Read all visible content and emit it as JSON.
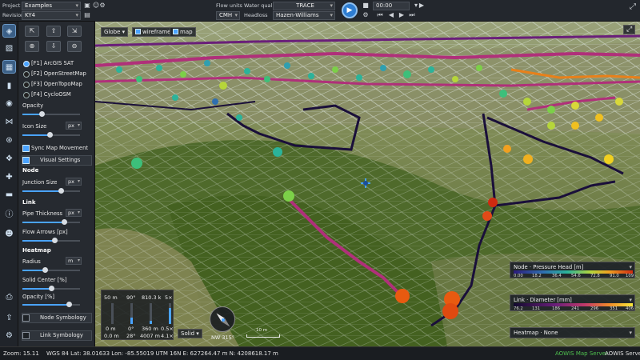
{
  "topbar": {
    "project_label": "Project",
    "project_value": "Examples",
    "revision_label": "Revision",
    "revision_value": "KY4",
    "flow_units_label": "Flow units",
    "flow_units_value": "CMH",
    "water_quality_label": "Water quality",
    "water_quality_value": "TRACE",
    "headloss_label": "Headloss",
    "headloss_value": "Hazen-Williams",
    "time_value": "00:00"
  },
  "panel": {
    "basemaps": [
      {
        "label": "[F1] ArcGIS SAT",
        "selected": true
      },
      {
        "label": "[F2] OpenStreetMap",
        "selected": false
      },
      {
        "label": "[F3] OpenTopoMap",
        "selected": false
      },
      {
        "label": "[F4] CycloOSM",
        "selected": false
      }
    ],
    "opacity_label": "Opacity",
    "icon_size_label": "Icon Size",
    "unit_px": "px",
    "unit_m": "m",
    "sync_map_label": "Sync Map Movement",
    "visual_settings_label": "Visual Settings",
    "node_heading": "Node",
    "junction_size_label": "Junction Size",
    "link_heading": "Link",
    "pipe_thickness_label": "Pipe Thickness",
    "flow_arrows_label": "Flow Arrows [px]",
    "heatmap_heading": "Heatmap",
    "radius_label": "Radius",
    "solid_center_label": "Solid Center [%]",
    "heat_opacity_label": "Opacity [%]",
    "node_symbology_label": "Node Symbology",
    "link_symbology_label": "Link Symbology"
  },
  "map": {
    "mode_value": "Globe",
    "wireframe_label": "wireframe",
    "map_label": "map",
    "camera": {
      "col1_top": "50 m",
      "col1_mid": "0 m",
      "col1_bot": "0.0 m",
      "col2_top": "90°",
      "col2_mid": "0°",
      "col2_bot": "28°",
      "col3_top": "810.3 k",
      "col3_mid": "360 m",
      "col3_bot": "4007 m",
      "col4_top": "5×",
      "col4_mid": "0.5×",
      "col4_bot": "4.1×"
    },
    "render_mode": "Solid",
    "heading_readout": "NW  315°",
    "scale_label": "10 m"
  },
  "legends": [
    {
      "title": "Node · Pressure Head [m]",
      "ticks": [
        "0.00",
        "18.2",
        "36.4",
        "54.6",
        "72.8",
        "91.0",
        "109"
      ]
    },
    {
      "title": "Link · Diameter [mm]",
      "ticks": [
        "76.2",
        "131",
        "186",
        "241",
        "296",
        "351",
        "406"
      ]
    },
    {
      "title": "Heatmap · None",
      "ticks": []
    }
  ],
  "status": {
    "zoom": "Zoom: 15.11",
    "coords": "WGS 84 Lat: 38.01633  Lon: -85.55019   UTM 16N E: 627264.47 m  N: 4208618.17 m",
    "map_server": "AOWIS Map Server",
    "server": "AOWIS Server"
  },
  "colors": {
    "accent": "#4aa3ff",
    "pipe_dark": "#1a0f3a",
    "pipe_magenta": "#b0307a",
    "pipe_orange": "#e8801a"
  }
}
